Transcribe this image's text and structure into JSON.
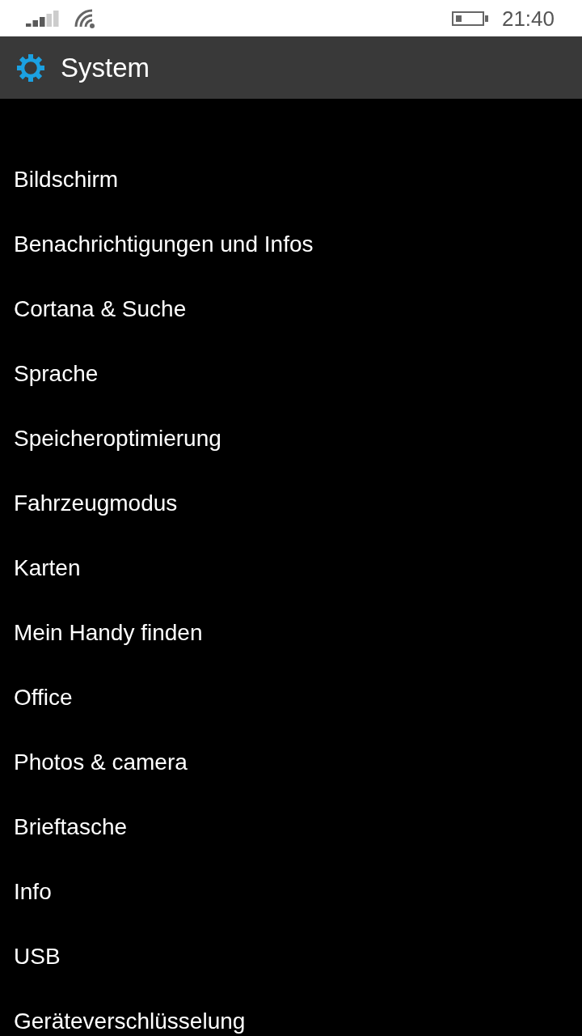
{
  "status_bar": {
    "time": "21:40"
  },
  "header": {
    "title": "System"
  },
  "items": [
    "Bildschirm",
    "Benachrichtigungen und Infos",
    "Cortana & Suche",
    "Sprache",
    "Speicheroptimierung",
    "Fahrzeugmodus",
    "Karten",
    "Mein Handy finden",
    "Office",
    "Photos & camera",
    "Brieftasche",
    "Info",
    "USB",
    "Geräteverschlüsselung"
  ]
}
